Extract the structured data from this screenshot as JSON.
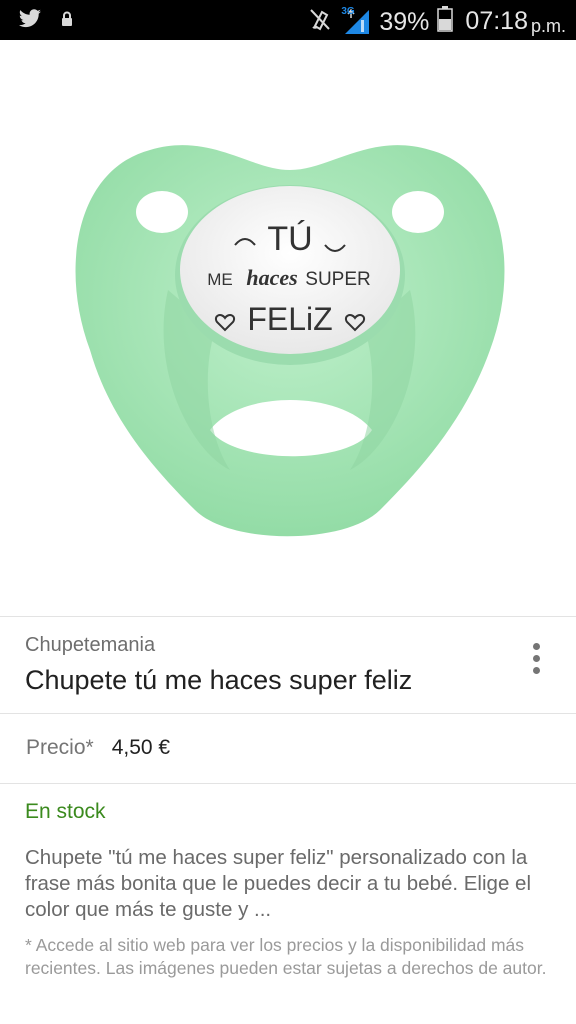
{
  "status_bar": {
    "network": "3G",
    "battery": "39%",
    "time": "07:18",
    "ampm": "p.m.",
    "icons": [
      "twitter-icon",
      "lock-icon",
      "mute-icon",
      "signal-icon",
      "battery-icon"
    ]
  },
  "product": {
    "image": {
      "line1": "TÚ",
      "line2a": "ME",
      "line2b": "haces",
      "line2c": "SUPER",
      "line3": "FELiZ",
      "color": "#a8e6b8"
    },
    "merchant": "Chupetemania",
    "title": "Chupete tú me haces super feliz",
    "price_label": "Precio*",
    "price": "4,50 €",
    "stock": "En stock",
    "description": "Chupete \"tú me haces super feliz\" personalizado con la frase más bonita que le puedes decir a tu bebé. Elige el color que más te guste y ...",
    "note": "* Accede al sitio web para ver los precios y la disponibilidad más recientes. Las imágenes pueden estar sujetas a derechos de autor."
  },
  "colors": {
    "stock": "#3b8a1e",
    "pacifier": "#a8e6b8",
    "status_bar": "#000000",
    "signal_accent": "#1e88e5"
  }
}
